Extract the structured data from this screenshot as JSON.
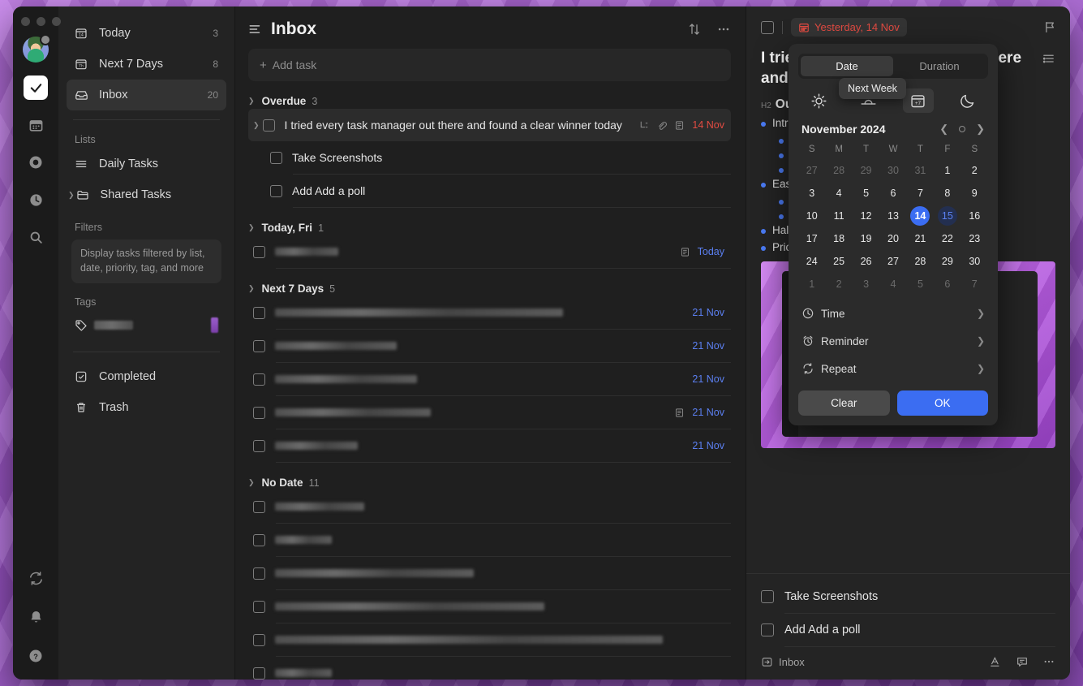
{
  "rail": {
    "items": [
      {
        "name": "tasks",
        "icon": "check-icon",
        "active": true
      },
      {
        "name": "calendar",
        "icon": "calendar-icon",
        "active": false
      },
      {
        "name": "habit",
        "icon": "target-icon",
        "active": false
      },
      {
        "name": "pomodoro",
        "icon": "clock-icon",
        "active": false
      },
      {
        "name": "search",
        "icon": "search-icon",
        "active": false
      }
    ],
    "bottom": [
      {
        "name": "sync",
        "icon": "sync-icon"
      },
      {
        "name": "notifications",
        "icon": "bell-icon"
      },
      {
        "name": "help",
        "icon": "help-icon"
      }
    ]
  },
  "sidebar": {
    "smart_lists": [
      {
        "label": "Today",
        "count": "3",
        "icon": "calendar-day-icon",
        "selected": false
      },
      {
        "label": "Next 7 Days",
        "count": "8",
        "icon": "calendar-week-icon",
        "selected": false
      },
      {
        "label": "Inbox",
        "count": "20",
        "icon": "inbox-icon",
        "selected": true
      }
    ],
    "lists_header": "Lists",
    "lists": [
      {
        "label": "Daily Tasks",
        "icon": "list-icon",
        "expandable": false
      },
      {
        "label": "Shared Tasks",
        "icon": "folder-icon",
        "expandable": true
      }
    ],
    "filters_header": "Filters",
    "filters_hint": "Display tasks filtered by list, date, priority, tag, and more",
    "tags_header": "Tags",
    "tag_redacted": true,
    "footer": [
      {
        "label": "Completed",
        "icon": "check-square-icon"
      },
      {
        "label": "Trash",
        "icon": "trash-icon"
      }
    ]
  },
  "list": {
    "title": "Inbox",
    "add_task_placeholder": "Add task",
    "sort_icon": "sort-icon",
    "more_icon": "ellipsis-icon",
    "groups": [
      {
        "name": "Overdue",
        "count": "3",
        "tasks": [
          {
            "text": "I tried every task manager out there and found a clear winner today",
            "date": "14 Nov",
            "date_style": "red",
            "selected": true,
            "redacted": false,
            "has_subtask_icon": true,
            "has_attachment": true,
            "has_note": true,
            "lines": 1
          },
          {
            "text": "Take Screenshots",
            "date": "",
            "date_style": "",
            "selected": false,
            "redacted": false,
            "sub": true,
            "lines": 1
          },
          {
            "text": "Add Add a poll",
            "date": "",
            "date_style": "",
            "selected": false,
            "redacted": false,
            "sub": true,
            "lines": 1
          }
        ]
      },
      {
        "name": "Today, Fri",
        "count": "1",
        "tasks": [
          {
            "text": "",
            "date": "Today",
            "date_style": "blue",
            "redacted": true,
            "has_note": true,
            "widths": [
              78,
              72
            ]
          }
        ]
      },
      {
        "name": "Next 7 Days",
        "count": "5",
        "tasks": [
          {
            "text": "",
            "date": "21 Nov",
            "date_style": "blue",
            "redacted": true,
            "widths": [
              355,
              352
            ]
          },
          {
            "text": "",
            "date": "21 Nov",
            "date_style": "blue",
            "redacted": true,
            "widths": [
              150,
              145
            ]
          },
          {
            "text": "",
            "date": "21 Nov",
            "date_style": "blue",
            "redacted": true,
            "widths": [
              175,
              172
            ]
          },
          {
            "text": "",
            "date": "21 Nov",
            "date_style": "blue",
            "redacted": true,
            "has_note": true,
            "widths": [
              190,
              188
            ]
          },
          {
            "text": "",
            "date": "21 Nov",
            "date_style": "blue",
            "redacted": true,
            "widths": [
              102,
              100
            ]
          }
        ]
      },
      {
        "name": "No Date",
        "count": "11",
        "tasks": [
          {
            "text": "",
            "date": "",
            "redacted": true,
            "widths": [
              110,
              108
            ]
          },
          {
            "text": "",
            "date": "",
            "redacted": true,
            "widths": [
              70,
              68
            ]
          },
          {
            "text": "",
            "date": "",
            "redacted": true,
            "widths": [
              245,
              242
            ]
          },
          {
            "text": "",
            "date": "",
            "redacted": true,
            "widths": [
              330,
              325
            ]
          },
          {
            "text": "",
            "date": "",
            "redacted": true,
            "widths": [
              475,
              470
            ]
          },
          {
            "text": "",
            "date": "",
            "redacted": true,
            "widths": [
              70,
              0
            ]
          }
        ]
      }
    ]
  },
  "detail": {
    "date_chip": "Yesterday, 14 Nov",
    "date_chip_icon": "calendar-icon",
    "flag_icon": "flag-icon",
    "title": "I tried every task manager out there and found a clear winner today",
    "outline_icon": "outline-icon",
    "heading_tag": "H2",
    "heading": "Outline",
    "bullets": [
      {
        "text": "Intro",
        "level": 1
      },
      {
        "text": "",
        "level": 2
      },
      {
        "text": "",
        "level": 2
      },
      {
        "text": "",
        "level": 2
      },
      {
        "text": "Easy",
        "level": 1
      },
      {
        "text": "",
        "level": 2
      },
      {
        "text": "",
        "level": 2
      },
      {
        "text": "Hal",
        "level": 1
      },
      {
        "text": "Prio",
        "level": 1
      }
    ],
    "subtasks": [
      {
        "label": "Take Screenshots",
        "checked": false
      },
      {
        "label": "Add Add a poll",
        "checked": false
      }
    ],
    "footer_list": "Inbox",
    "footer_list_icon": "move-to-icon",
    "footer_actions": [
      {
        "name": "format-text-icon"
      },
      {
        "name": "comment-icon"
      },
      {
        "name": "ellipsis-icon"
      }
    ]
  },
  "date_popup": {
    "tabs": [
      {
        "label": "Date",
        "active": true
      },
      {
        "label": "Duration",
        "active": false
      }
    ],
    "quick_options": [
      {
        "name": "today-icon",
        "label": "Today",
        "highlight": false
      },
      {
        "name": "tomorrow-icon",
        "label": "Tomorrow",
        "highlight": false
      },
      {
        "name": "next-week-icon",
        "label": "Next Week",
        "highlight": true
      },
      {
        "name": "night-icon",
        "label": "This Evening",
        "highlight": false
      }
    ],
    "tooltip": "Next Week",
    "month_label": "November 2024",
    "prev_icon": "chevron-left-icon",
    "today_dot_icon": "today-circle-icon",
    "next_icon": "chevron-right-icon",
    "weekdays": [
      "S",
      "M",
      "T",
      "W",
      "T",
      "F",
      "S"
    ],
    "weeks": [
      [
        {
          "d": "27",
          "out": true
        },
        {
          "d": "28",
          "out": true
        },
        {
          "d": "29",
          "out": true
        },
        {
          "d": "30",
          "out": true
        },
        {
          "d": "31",
          "out": true
        },
        {
          "d": "1"
        },
        {
          "d": "2"
        }
      ],
      [
        {
          "d": "3"
        },
        {
          "d": "4"
        },
        {
          "d": "5"
        },
        {
          "d": "6"
        },
        {
          "d": "7"
        },
        {
          "d": "8"
        },
        {
          "d": "9"
        }
      ],
      [
        {
          "d": "10"
        },
        {
          "d": "11"
        },
        {
          "d": "12"
        },
        {
          "d": "13"
        },
        {
          "d": "14",
          "selected": true
        },
        {
          "d": "15",
          "today": true
        },
        {
          "d": "16"
        }
      ],
      [
        {
          "d": "17"
        },
        {
          "d": "18"
        },
        {
          "d": "19"
        },
        {
          "d": "20"
        },
        {
          "d": "21"
        },
        {
          "d": "22"
        },
        {
          "d": "23"
        }
      ],
      [
        {
          "d": "24"
        },
        {
          "d": "25"
        },
        {
          "d": "26"
        },
        {
          "d": "27"
        },
        {
          "d": "28"
        },
        {
          "d": "29"
        },
        {
          "d": "30"
        }
      ],
      [
        {
          "d": "1",
          "out": true
        },
        {
          "d": "2",
          "out": true
        },
        {
          "d": "3",
          "out": true
        },
        {
          "d": "4",
          "out": true
        },
        {
          "d": "5",
          "out": true
        },
        {
          "d": "6",
          "out": true
        },
        {
          "d": "7",
          "out": true
        }
      ]
    ],
    "options": [
      {
        "label": "Time",
        "icon": "clock-icon"
      },
      {
        "label": "Reminder",
        "icon": "alarm-icon"
      },
      {
        "label": "Repeat",
        "icon": "repeat-icon"
      }
    ],
    "clear_label": "Clear",
    "ok_label": "OK"
  },
  "colors": {
    "accent_blue": "#3b6df2",
    "overdue_red": "#e24b42",
    "date_blue": "#5b7ff0",
    "window_bg": "#1f1f1f",
    "sidebar_bg": "#232323",
    "desktop": "#b359dd"
  }
}
